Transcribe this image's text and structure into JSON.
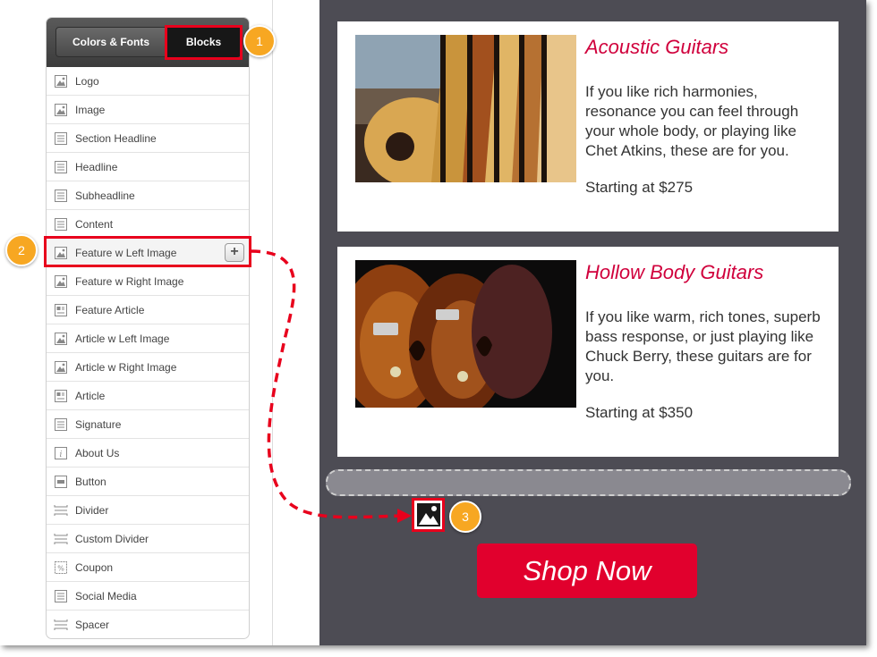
{
  "sidebar": {
    "tabs": [
      {
        "label": "Colors & Fonts"
      },
      {
        "label": "Blocks"
      }
    ],
    "items": [
      {
        "label": "Logo",
        "icon": "image-icon"
      },
      {
        "label": "Image",
        "icon": "image-icon"
      },
      {
        "label": "Section Headline",
        "icon": "text-icon"
      },
      {
        "label": "Headline",
        "icon": "text-icon"
      },
      {
        "label": "Subheadline",
        "icon": "text-icon"
      },
      {
        "label": "Content",
        "icon": "text-icon"
      },
      {
        "label": "Feature w Left Image",
        "icon": "image-icon"
      },
      {
        "label": "Feature w Right Image",
        "icon": "image-icon"
      },
      {
        "label": "Feature Article",
        "icon": "article-icon"
      },
      {
        "label": "Article w Left Image",
        "icon": "image-icon"
      },
      {
        "label": "Article w Right Image",
        "icon": "image-icon"
      },
      {
        "label": "Article",
        "icon": "article-icon"
      },
      {
        "label": "Signature",
        "icon": "text-icon"
      },
      {
        "label": "About Us",
        "icon": "info-icon"
      },
      {
        "label": "Button",
        "icon": "button-icon"
      },
      {
        "label": "Divider",
        "icon": "divider-icon"
      },
      {
        "label": "Custom Divider",
        "icon": "divider-icon"
      },
      {
        "label": "Coupon",
        "icon": "coupon-icon"
      },
      {
        "label": "Social Media",
        "icon": "text-icon"
      },
      {
        "label": "Spacer",
        "icon": "divider-icon"
      }
    ],
    "add_button_label": "+"
  },
  "email": {
    "cards": [
      {
        "title": "Acoustic Guitars",
        "description": "If you like rich harmonies, resonance you can feel through your whole body, or playing like Chet Atkins, these are for you.",
        "price": "Starting at $275"
      },
      {
        "title": "Hollow Body Guitars",
        "description": "If you like warm, rich tones, superb bass response, or just playing like Chuck Berry, these guitars are for you.",
        "price": "Starting at $350"
      }
    ],
    "cta_label": "Shop Now"
  },
  "callouts": [
    "1",
    "2",
    "3"
  ],
  "colors": {
    "accent_red": "#e1002d",
    "title_red": "#d0003c",
    "callout_orange": "#f7a722",
    "canvas_bg": "#4d4c54"
  }
}
